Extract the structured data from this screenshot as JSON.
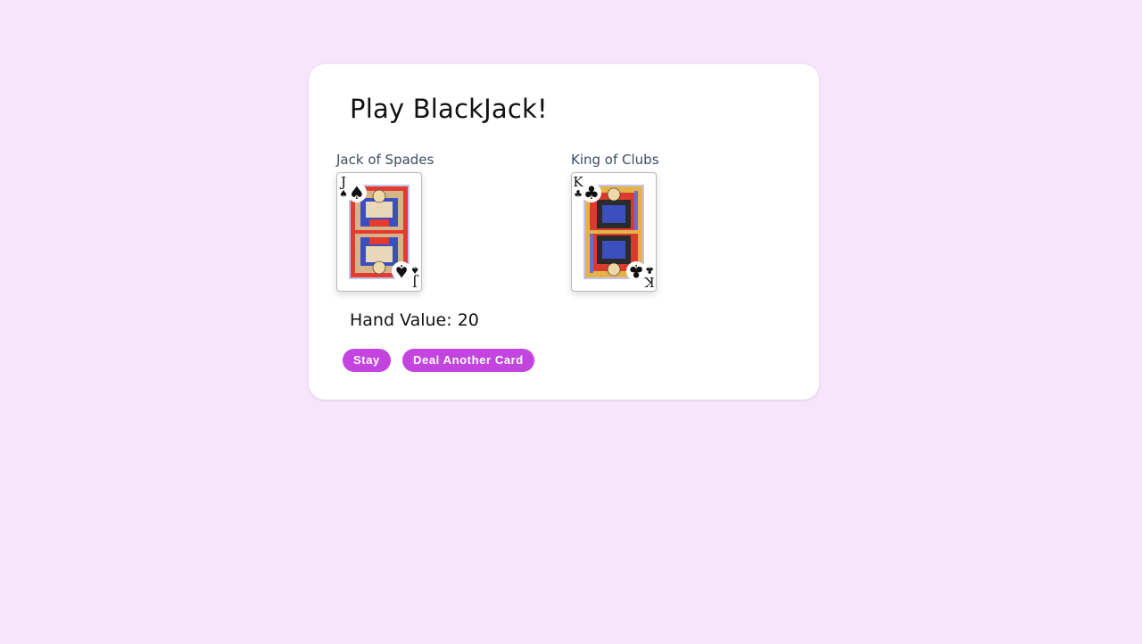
{
  "title": "Play BlackJack!",
  "cards": [
    {
      "caption": "Jack of Spades",
      "rank": "J",
      "suit": "♠",
      "suit_color": "#111111"
    },
    {
      "caption": "King of Clubs",
      "rank": "K",
      "suit": "♣",
      "suit_color": "#111111"
    }
  ],
  "hand_value_label": "Hand Value: 20",
  "buttons": {
    "stay": "Stay",
    "deal": "Deal Another Card"
  },
  "colors": {
    "background": "#f6e5fb",
    "panel": "#ffffff",
    "button": "#c344de",
    "caption": "#3b4c66"
  }
}
